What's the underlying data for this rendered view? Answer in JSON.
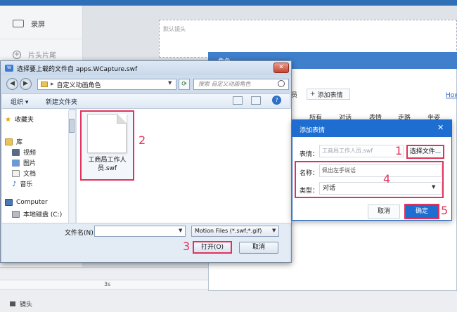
{
  "background_app": {
    "left_items": [
      {
        "label": "录屏",
        "icon": "record-icon"
      },
      {
        "label": "片头片尾",
        "icon": "plus-circle-icon"
      }
    ],
    "stage_label": "默认镜头",
    "camera_track_label": "镜头",
    "ruler_mark": "3s"
  },
  "role_panel": {
    "title": "角色",
    "add_expression": "添加表情",
    "help_link": "How",
    "side_label": "员",
    "tabs": [
      "所有",
      "对话",
      "表情",
      "走路",
      "坐姿"
    ]
  },
  "file_dialog": {
    "title": "选择要上载的文件自 apps.WCapture.swf",
    "address": "自定义动画角色",
    "search_placeholder": "搜索 自定义动画角色",
    "toolbar": {
      "organize": "组织 ▾",
      "new_folder": "新建文件夹"
    },
    "nav_items": [
      {
        "label": "收藏夹",
        "icon": "star-icon"
      },
      {
        "label": "库",
        "icon": "library-icon"
      },
      {
        "label": "视频",
        "icon": "video-icon"
      },
      {
        "label": "图片",
        "icon": "picture-icon"
      },
      {
        "label": "文档",
        "icon": "document-icon"
      },
      {
        "label": "音乐",
        "icon": "music-icon"
      },
      {
        "label": "Computer",
        "icon": "computer-icon"
      },
      {
        "label": "本地磁盘 (C:)",
        "icon": "disk-icon"
      }
    ],
    "file": {
      "name": "工商局工作人员.swf"
    },
    "filename_label": "文件名(N):",
    "filename_value": "",
    "filetype_value": "Motion Files (*.swf;*.gif)",
    "open_button": "打开(O)",
    "cancel_button": "取消"
  },
  "expression_dialog": {
    "title": "添加表情",
    "expression_label": "表情：",
    "expression_value": "工商局工作人员.swf",
    "select_file_button": "选择文件...",
    "name_label": "名称：",
    "name_value": "佩出左手说话",
    "type_label": "类型：",
    "type_value": "对话",
    "cancel_button": "取消",
    "ok_button": "确定"
  },
  "steps": [
    "1",
    "2",
    "3",
    "4",
    "5"
  ],
  "colors": {
    "highlight": "#e1325b",
    "accent_blue": "#1e6ed1"
  }
}
